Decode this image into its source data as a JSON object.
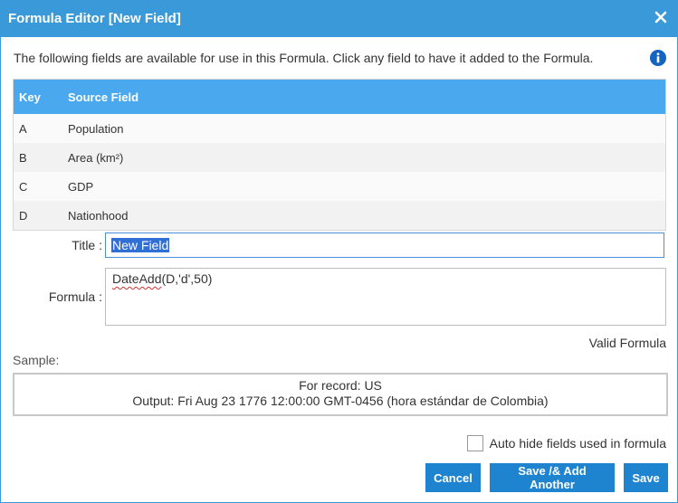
{
  "dialog": {
    "title": "Formula Editor [New Field]",
    "close_icon": "close-icon"
  },
  "intro_text": "The following fields are available for use in this Formula. Click any field to have it added to the Formula.",
  "info_icon": "info-icon",
  "table": {
    "headers": {
      "key": "Key",
      "source": "Source Field"
    },
    "rows": [
      {
        "key": "A",
        "source": "Population"
      },
      {
        "key": "B",
        "source": "Area (km²)"
      },
      {
        "key": "C",
        "source": "GDP"
      },
      {
        "key": "D",
        "source": "Nationhood"
      }
    ]
  },
  "form": {
    "title_label": "Title :",
    "title_value": "New Field",
    "formula_label": "Formula :",
    "formula_func": "DateAdd",
    "formula_args": "(D,'d',50)"
  },
  "validation": "Valid Formula",
  "sample": {
    "label": "Sample:",
    "record": "For record: US",
    "output": "Output: Fri Aug 23 1776 12:00:00 GMT-0456 (hora estándar de Colombia)"
  },
  "auto_hide": {
    "label": "Auto hide fields used in formula",
    "checked": false
  },
  "buttons": {
    "cancel": "Cancel",
    "save_add": "Save /& Add Another",
    "save": "Save"
  },
  "colors": {
    "titlebar": "#3a9ad9",
    "table_header": "#4aa9ee",
    "button": "#1f84cf",
    "info_icon": "#1565c0"
  }
}
